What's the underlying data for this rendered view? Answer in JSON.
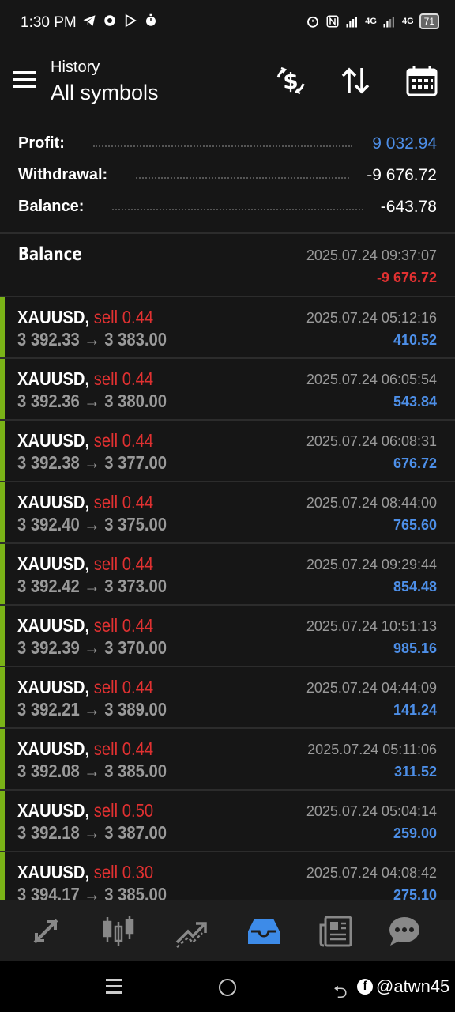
{
  "status_bar": {
    "time": "1:30 PM",
    "battery": "71",
    "network_1": "4G",
    "network_2": "4G"
  },
  "app_bar": {
    "title": "History",
    "subtitle": "All symbols",
    "icons": [
      "menu-icon",
      "currency-exchange-icon",
      "sort-icon",
      "calendar-icon"
    ]
  },
  "summary": {
    "profit_label": "Profit:",
    "profit_value": "9 032.94",
    "withdrawal_label": "Withdrawal:",
    "withdrawal_value": "-9 676.72",
    "balance_label": "Balance:",
    "balance_value": "-643.78"
  },
  "balance_entry": {
    "title": "Balance",
    "date": "2025.07.24 09:37:07",
    "amount": "-9 676.72"
  },
  "trades": [
    {
      "symbol": "XAUUSD,",
      "side": "sell 0.44",
      "prices": "3 392.33 → 3 383.00",
      "date": "2025.07.24 05:12:16",
      "profit": "410.52"
    },
    {
      "symbol": "XAUUSD,",
      "side": "sell 0.44",
      "prices": "3 392.36 → 3 380.00",
      "date": "2025.07.24 06:05:54",
      "profit": "543.84"
    },
    {
      "symbol": "XAUUSD,",
      "side": "sell 0.44",
      "prices": "3 392.38 → 3 377.00",
      "date": "2025.07.24 06:08:31",
      "profit": "676.72"
    },
    {
      "symbol": "XAUUSD,",
      "side": "sell 0.44",
      "prices": "3 392.40 → 3 375.00",
      "date": "2025.07.24 08:44:00",
      "profit": "765.60"
    },
    {
      "symbol": "XAUUSD,",
      "side": "sell 0.44",
      "prices": "3 392.42 → 3 373.00",
      "date": "2025.07.24 09:29:44",
      "profit": "854.48"
    },
    {
      "symbol": "XAUUSD,",
      "side": "sell 0.44",
      "prices": "3 392.39 → 3 370.00",
      "date": "2025.07.24 10:51:13",
      "profit": "985.16"
    },
    {
      "symbol": "XAUUSD,",
      "side": "sell 0.44",
      "prices": "3 392.21 → 3 389.00",
      "date": "2025.07.24 04:44:09",
      "profit": "141.24"
    },
    {
      "symbol": "XAUUSD,",
      "side": "sell 0.44",
      "prices": "3 392.08 → 3 385.00",
      "date": "2025.07.24 05:11:06",
      "profit": "311.52"
    },
    {
      "symbol": "XAUUSD,",
      "side": "sell 0.50",
      "prices": "3 392.18 → 3 387.00",
      "date": "2025.07.24 05:04:14",
      "profit": "259.00"
    },
    {
      "symbol": "XAUUSD,",
      "side": "sell 0.30",
      "prices": "3 394.17 → 3 385.00",
      "date": "2025.07.24 04:08:42",
      "profit": "275.10"
    }
  ],
  "bottom_nav": {
    "items": [
      "quotes-icon",
      "chart-icon",
      "trade-icon",
      "history-icon",
      "news-icon",
      "messages-icon"
    ],
    "active": "history-icon"
  },
  "system_nav": {
    "watermark": "@atwn45"
  },
  "colors": {
    "background": "#161616",
    "profit_blue": "#4d8fe8",
    "loss_red": "#e03131",
    "buy_green_bar": "#7ab317",
    "nav_active": "#3d8be8"
  }
}
